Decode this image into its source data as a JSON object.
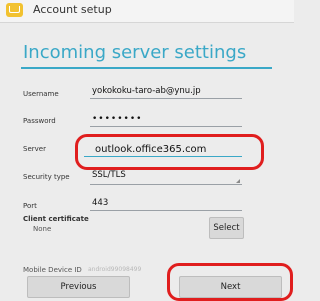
{
  "window": {
    "title": "Account setup",
    "icon": "mail-icon"
  },
  "page": {
    "heading": "Incoming server settings"
  },
  "form": {
    "username": {
      "label": "Username",
      "value": "yokokoku-taro-ab@ynu.jp"
    },
    "password": {
      "label": "Password",
      "value": "••••••••"
    },
    "server": {
      "label": "Server",
      "value": "outlook.office365.com"
    },
    "security": {
      "label": "Security type",
      "value": "SSL/TLS"
    },
    "port": {
      "label": "Port",
      "value": "443"
    },
    "client_certificate": {
      "label": "Client certificate",
      "value": "None",
      "button": "Select"
    },
    "device_id": {
      "label": "Mobile Device ID",
      "value": "android99098499"
    }
  },
  "footer": {
    "previous": "Previous",
    "next": "Next"
  },
  "colors": {
    "accent": "#3aa8c7",
    "highlight": "#e01e1e"
  }
}
